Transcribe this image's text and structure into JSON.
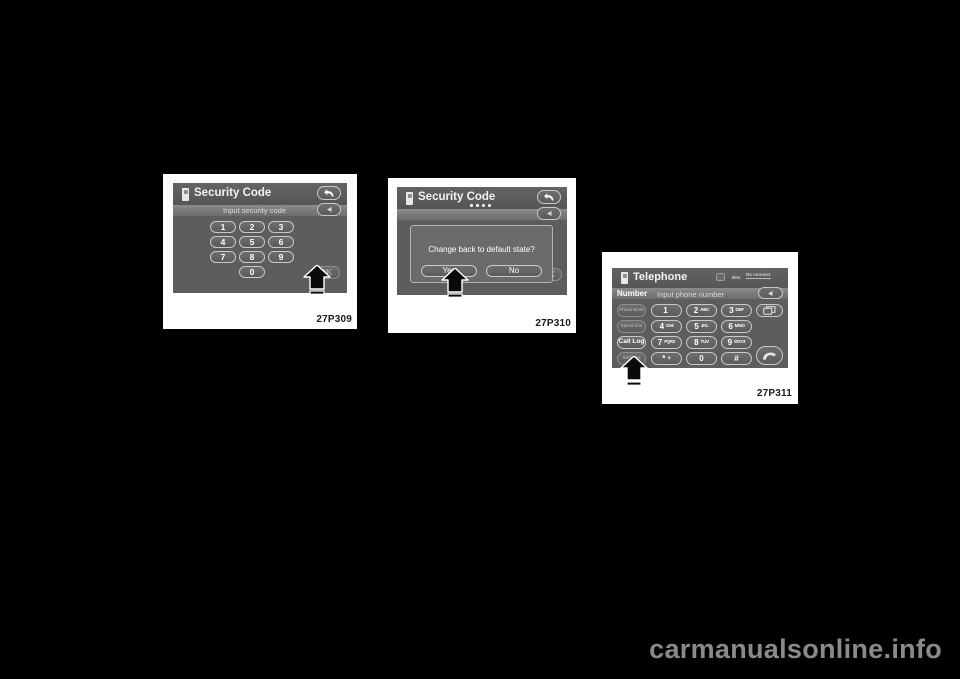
{
  "page": {
    "background_color": "#000000",
    "watermark": "carmanualsonline.info"
  },
  "figures": [
    {
      "id": "figure-security-code-entry",
      "caption": "27P309",
      "screen": {
        "title": "Security Code",
        "title_icon": "phone-handset-icon",
        "return_button": "return-icon",
        "subbar_hint": "Input security code",
        "delete_button": "delete-left-icon",
        "keypad": [
          "1",
          "2",
          "3",
          "4",
          "5",
          "6",
          "7",
          "8",
          "9",
          "0"
        ],
        "ok_button": "OK"
      },
      "callout": "up-arrow-pointing-to-ok"
    },
    {
      "id": "figure-security-code-confirm",
      "caption": "27P310",
      "screen": {
        "title": "Security Code",
        "title_icon": "phone-handset-icon",
        "return_button": "return-icon",
        "entered_code_dots": 4,
        "delete_button": "delete-left-icon",
        "ok_button": "OK",
        "dialog": {
          "message": "Change back to default state?",
          "yes_label": "Yes",
          "no_label": "No"
        }
      },
      "callout": "up-arrow-pointing-to-yes"
    },
    {
      "id": "figure-telephone-keypad",
      "caption": "27P311",
      "screen": {
        "title": "Telephone",
        "title_icon": "phone-handset-icon",
        "status": {
          "roaming_icon": "roaming-icon",
          "signal_label": "Bits",
          "battery_label": "No connect"
        },
        "field_label": "Number",
        "field_placeholder": "Input phone number",
        "delete_button": "delete-left-icon",
        "display_button": "display-icon",
        "call_button": "call-handset-icon",
        "side_buttons": [
          "Phone Book",
          "Speed Dial",
          "Call Log",
          "Settings"
        ],
        "keypad": [
          {
            "digit": "1",
            "letters": ""
          },
          {
            "digit": "2",
            "letters": "ABC"
          },
          {
            "digit": "3",
            "letters": "DEF"
          },
          {
            "digit": "4",
            "letters": "GHI"
          },
          {
            "digit": "5",
            "letters": "JKL"
          },
          {
            "digit": "6",
            "letters": "MNO"
          },
          {
            "digit": "7",
            "letters": "PQRS"
          },
          {
            "digit": "8",
            "letters": "TUV"
          },
          {
            "digit": "9",
            "letters": "WXYZ"
          },
          {
            "digit": "*",
            "letters": "+"
          },
          {
            "digit": "0",
            "letters": ""
          },
          {
            "digit": "#",
            "letters": ""
          }
        ]
      },
      "callout": "up-arrow-pointing-to-settings"
    }
  ]
}
